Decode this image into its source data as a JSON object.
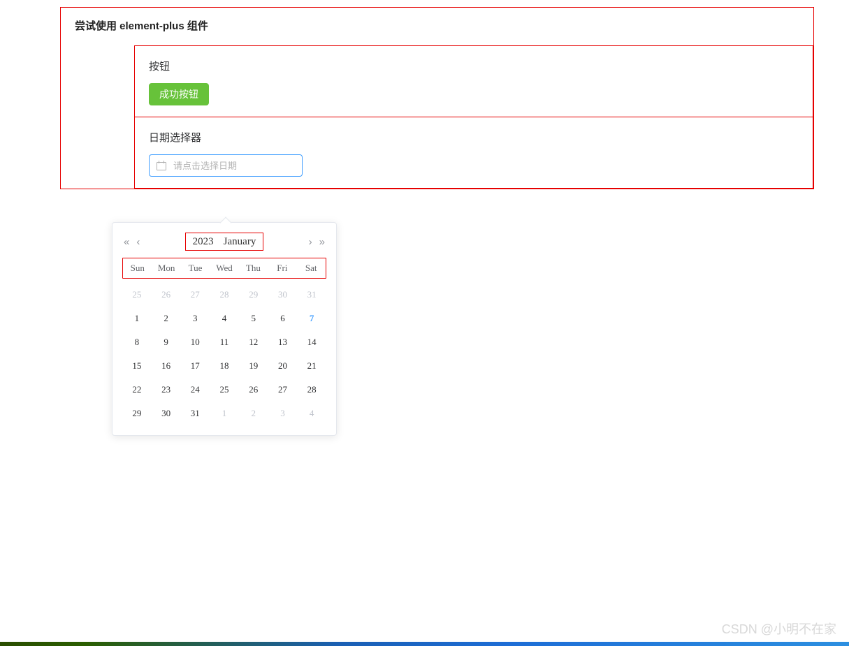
{
  "page": {
    "title": "尝试使用 element-plus 组件"
  },
  "sections": {
    "button": {
      "title": "按钮",
      "success_label": "成功按钮"
    },
    "datepicker": {
      "title": "日期选择器",
      "placeholder": "请点击选择日期"
    }
  },
  "calendar": {
    "year": "2023",
    "month": "January",
    "weekdays": [
      "Sun",
      "Mon",
      "Tue",
      "Wed",
      "Thu",
      "Fri",
      "Sat"
    ],
    "weeks": [
      [
        {
          "d": "25",
          "other": true
        },
        {
          "d": "26",
          "other": true
        },
        {
          "d": "27",
          "other": true
        },
        {
          "d": "28",
          "other": true
        },
        {
          "d": "29",
          "other": true
        },
        {
          "d": "30",
          "other": true
        },
        {
          "d": "31",
          "other": true
        }
      ],
      [
        {
          "d": "1"
        },
        {
          "d": "2"
        },
        {
          "d": "3"
        },
        {
          "d": "4"
        },
        {
          "d": "5"
        },
        {
          "d": "6"
        },
        {
          "d": "7",
          "today": true
        }
      ],
      [
        {
          "d": "8"
        },
        {
          "d": "9"
        },
        {
          "d": "10"
        },
        {
          "d": "11"
        },
        {
          "d": "12"
        },
        {
          "d": "13"
        },
        {
          "d": "14"
        }
      ],
      [
        {
          "d": "15"
        },
        {
          "d": "16"
        },
        {
          "d": "17"
        },
        {
          "d": "18"
        },
        {
          "d": "19"
        },
        {
          "d": "20"
        },
        {
          "d": "21"
        }
      ],
      [
        {
          "d": "22"
        },
        {
          "d": "23"
        },
        {
          "d": "24"
        },
        {
          "d": "25"
        },
        {
          "d": "26"
        },
        {
          "d": "27"
        },
        {
          "d": "28"
        }
      ],
      [
        {
          "d": "29"
        },
        {
          "d": "30"
        },
        {
          "d": "31"
        },
        {
          "d": "1",
          "other": true
        },
        {
          "d": "2",
          "other": true
        },
        {
          "d": "3",
          "other": true
        },
        {
          "d": "4",
          "other": true
        }
      ]
    ],
    "nav": {
      "prev_year": "«",
      "prev_month": "‹",
      "next_month": "›",
      "next_year": "»"
    }
  },
  "watermark": "CSDN @小明不在家"
}
